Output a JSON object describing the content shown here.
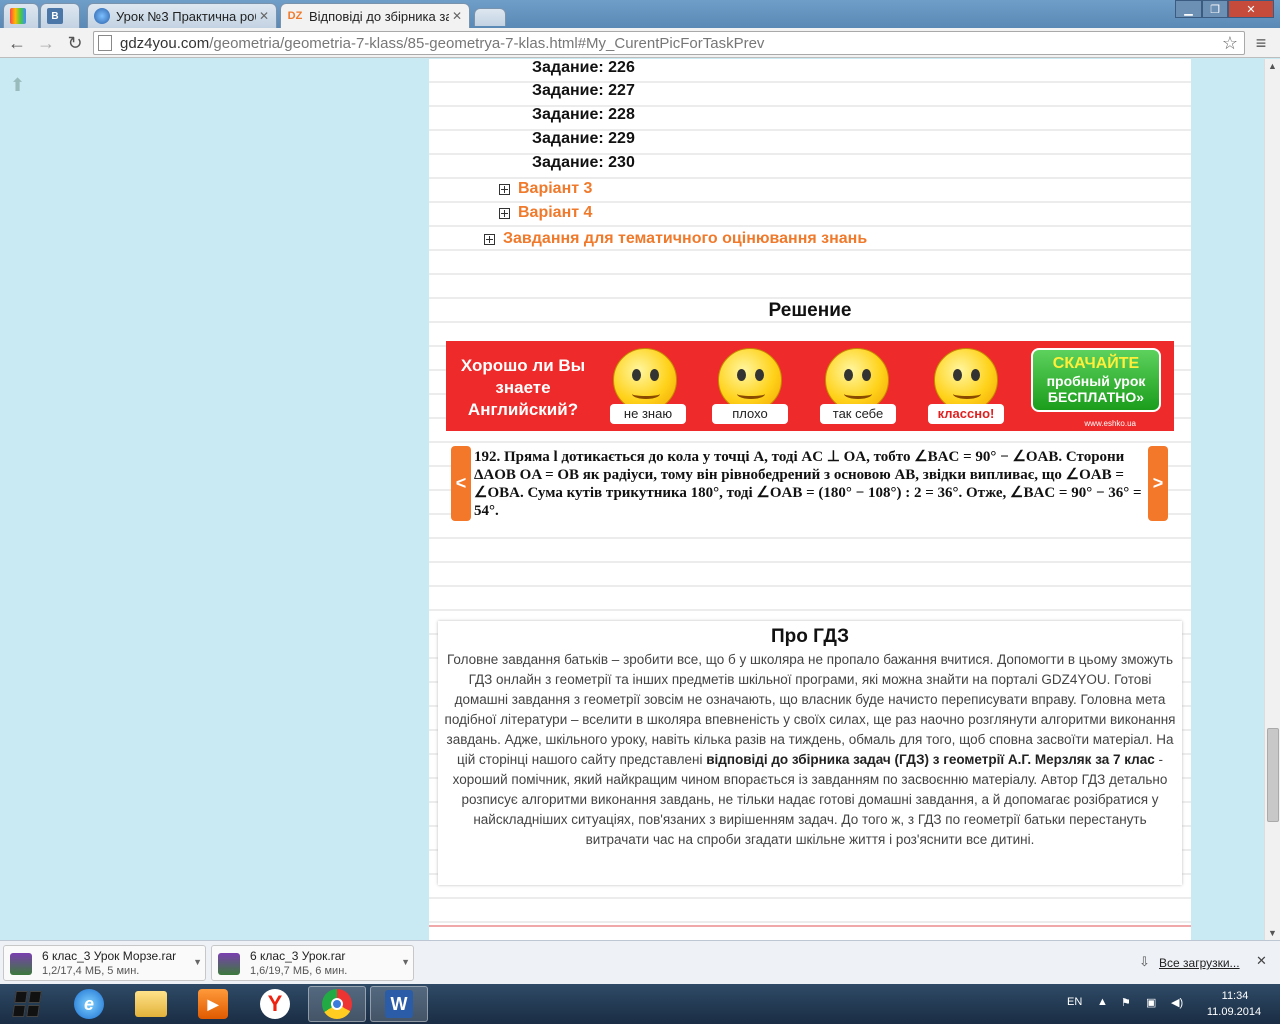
{
  "browser": {
    "tabs": [
      {
        "label": "",
        "icon": "rainbow-icon"
      },
      {
        "label": "",
        "icon": "vk-icon"
      },
      {
        "label": "Урок №3 Практична роб",
        "icon": "globe-icon"
      },
      {
        "label": "Відповіді до збірника зад",
        "icon": "gdz-icon"
      },
      {
        "label": "",
        "icon": "new-tab-icon"
      }
    ],
    "url_host": "gdz4you.com",
    "url_path": "/geometria/geometria-7-klass/85-geometrya-7-klas.html#My_CurentPicForTaskPrev"
  },
  "page": {
    "tasks": [
      "Задание: 226",
      "Задание: 227",
      "Задание: 228",
      "Задание: 229",
      "Задание: 230"
    ],
    "variants": [
      "Варіант 3",
      "Варіант 4"
    ],
    "thematic": "Завдання для тематичного оцінювання знань",
    "solution_heading": "Решение",
    "ad": {
      "question": "Хорошо ли Вы знаете Английский?",
      "options": [
        "не знаю",
        "плохо",
        "так себе",
        "классно!"
      ],
      "cta_line1": "СКАЧАЙТЕ",
      "cta_line2": "пробный урок",
      "cta_line3": "БЕСПЛАТНО»",
      "site": "www.eshko.ua"
    },
    "solution": {
      "number": "192.",
      "text": "Пряма l дотикається до кола у точці A, тоді AC ⊥ OA, тобто ∠BAC = 90° − ∠OAB. Сторони ΔAOB  OA = OB як радіуси, тому він рівнобедрений з основою AB, звідки випливає, що ∠OAB = ∠OBA. Сума кутів трикутника 180°, тоді ∠OAB = (180° − 108°) : 2 = 36°. Отже, ∠BAC = 90° − 36° = 54°.",
      "prev": "<",
      "next": ">"
    },
    "about": {
      "title": "Про ГДЗ",
      "text_before": "Головне завдання батьків – зробити все, що б у школяра не пропало бажання вчитися. Допомогти в цьому зможуть ГДЗ онлайн з геометрії та інших предметів шкільної програми, які можна знайти на порталі GDZ4YOU. Готові домашні завдання з геометрії зовсім не означають, що власник буде начисто переписувати вправу. Головна мета подібної літератури – вселити в школяра впевненість у своїх силах, ще раз наочно розглянути алгоритми виконання завдань. Адже, шкільного уроку, навіть кілька разів на тиждень, обмаль для того, щоб сповна засвоїти матеріал. На цій сторінці нашого сайту представлені ",
      "text_bold": "відповіді до збірника задач (ГДЗ) з геометрії А.Г. Мерзляк за 7 клас",
      "text_after": " - хороший помічник, який найкращим чином впорається із завданням по засвоєнню матеріалу. Автор ГДЗ детально розписує алгоритми виконання завдань, не тільки надає готові домашні завдання, а й допомагає розібратися у найскладніших ситуаціях, пов'язаних з вирішенням задач. До того ж, з ГДЗ по геометрії батьки перестануть витрачати час на спроби згадати шкільне життя і роз'яснити все дитині."
    }
  },
  "downloads": {
    "items": [
      {
        "name": "6 клас_3 Урок Морзе.rar",
        "info": "1,2/17,4 МБ, 5 мин."
      },
      {
        "name": "6 клас_3 Урок.rar",
        "info": "1,6/19,7 МБ, 6 мин."
      }
    ],
    "all_label": "Все загрузки..."
  },
  "taskbar": {
    "lang": "EN",
    "time": "11:34",
    "date": "11.09.2014"
  }
}
